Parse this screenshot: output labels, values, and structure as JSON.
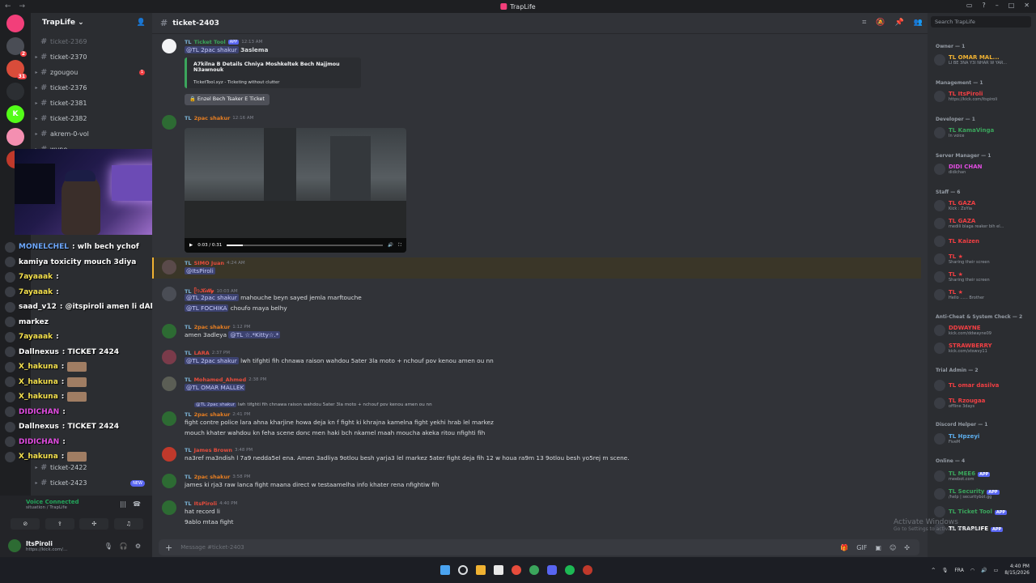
{
  "window": {
    "title": "TrapLife",
    "nav_back": "←",
    "nav_fwd": "→"
  },
  "rail": {
    "servers": [
      {
        "label": "",
        "color": "#f23f7a"
      },
      {
        "label": "",
        "color": "#4a4d55",
        "badge": "2"
      },
      {
        "label": "",
        "color": "#d94c3a",
        "badge": "31"
      },
      {
        "label": "",
        "color": "#2c2f33"
      },
      {
        "label": "K",
        "color": "#53fc18"
      },
      {
        "label": "",
        "color": "#f48fb1"
      },
      {
        "label": "",
        "color": "#c0392b"
      }
    ]
  },
  "server": {
    "name": "TrapLife"
  },
  "channels": [
    {
      "name": "ticket-2369",
      "arrow": false,
      "dim": true
    },
    {
      "name": "ticket-2370",
      "arrow": true
    },
    {
      "name": "zgougou",
      "arrow": true,
      "badge": "1"
    },
    {
      "name": "ticket-2376",
      "arrow": true
    },
    {
      "name": "ticket-2381",
      "arrow": true
    },
    {
      "name": "ticket-2382",
      "arrow": true
    },
    {
      "name": "akrem-0-vol",
      "arrow": true
    },
    {
      "name": "wyne",
      "arrow": true
    }
  ],
  "channels_bottom": [
    {
      "name": "ticket-2422",
      "arrow": true
    },
    {
      "name": "ticket-2423",
      "arrow": true,
      "new": "NEW"
    }
  ],
  "overlay": [
    {
      "name": "MONELCHEL",
      "name_color": "#6ea8fe",
      "text": ": wlh bech ychof",
      "emote": false
    },
    {
      "name": "kamiya toxicity mouch 3diya",
      "name_color": "#ffffff",
      "text": "",
      "emote": false
    },
    {
      "name": "7ayaaak",
      "name_color": "#f4e04d",
      "text": ":",
      "emote": false
    },
    {
      "name": "7ayaaak",
      "name_color": "#f4e04d",
      "text": ":",
      "emote": false
    },
    {
      "name": "saad_v12",
      "name_color": "#ffffff",
      "text": ": @itspiroli amen li dAkhl",
      "emote": false
    },
    {
      "name": "markez",
      "name_color": "#ffffff",
      "text": "",
      "emote": false
    },
    {
      "name": "7ayaaak",
      "name_color": "#f4e04d",
      "text": ":",
      "emote": false
    },
    {
      "name": "Dallnexus",
      "name_color": "#ffffff",
      "text": ": TICKET 2424",
      "emote": false
    },
    {
      "name": "X_hakuna",
      "name_color": "#f4e04d",
      "text": ":",
      "emote": true
    },
    {
      "name": "X_hakuna",
      "name_color": "#f4e04d",
      "text": ":",
      "emote": true
    },
    {
      "name": "X_hakuna",
      "name_color": "#f4e04d",
      "text": ":",
      "emote": true
    },
    {
      "name": "DIDICHAN",
      "name_color": "#e04ce0",
      "text": ":",
      "emote": false
    },
    {
      "name": "Dallnexus",
      "name_color": "#ffffff",
      "text": ": TICKET 2424",
      "emote": false
    },
    {
      "name": "DIDICHAN",
      "name_color": "#e04ce0",
      "text": ":",
      "emote": false
    },
    {
      "name": "X_hakuna",
      "name_color": "#f4e04d",
      "text": ":",
      "emote": true
    }
  ],
  "voice": {
    "title": "Voice Connected",
    "sub": "situation / TrapLife"
  },
  "user": {
    "name": "ItsPiroli",
    "status": "https://kick.com/..."
  },
  "channel": {
    "name": "ticket-2403",
    "placeholder": "Message #ticket-2403"
  },
  "messages": {
    "m1": {
      "tag": "TL",
      "user": "Ticket Tool",
      "app": "APP",
      "time": "12:13 AM",
      "mention": "@TL 2pac shakur",
      "text": "3aslema",
      "embed_title": "A7kilna B Details Chniya Moshkeltek Bech Najjmou N3awnouk",
      "embed_footer": "TicketTool.xyz - Ticketing without clutter",
      "button": "Enzel Bech Tsaker E Ticket"
    },
    "m2": {
      "tag": "TL",
      "user": "2pac shakur",
      "time": "12:16 AM",
      "video_time": "0:03 / 0:31"
    },
    "m3": {
      "tag": "TL",
      "user": "SIMO Juan",
      "time": "4:24 AM",
      "mention": "@ItsPiroli"
    },
    "m4": {
      "tag": "TL",
      "user": "ᥫ᭡𝓚𝓲𝓽𝓽𝔂",
      "time": "10:03 AM",
      "l1_mention": "@TL 2pac shakur",
      "l1_text": "mahouche beyn sayed jemla marftouche",
      "l2_mention": "@TL FOCHIKA",
      "l2_text": "choufo maya belhy"
    },
    "m5": {
      "tag": "TL",
      "user": "2pac shakur",
      "time": "1:12 PM",
      "text": "amen 3adleya",
      "mention": "@TL ☆.*Kitty☆.*"
    },
    "m6": {
      "tag": "TL",
      "user": "LARA",
      "time": "2:37 PM",
      "mention": "@TL 2pac shakur",
      "text": "lwh tifghti fih chnawa raison wahdou 5ater 3la moto + nchouf pov kenou amen ou nn"
    },
    "m7": {
      "tag": "TL",
      "user": "Mohamed_Ahmed",
      "time": "2:38 PM",
      "mention": "@TL OMAR MALLEK"
    },
    "m8": {
      "tag": "TL",
      "user": "2pac shakur",
      "time": "2:41 PM",
      "reply_mention": "@TL 2pac shakur",
      "reply": "lwh tifghti fih chnawa raison wahdou 5ater 3la moto + nchouf pov kenou amen ou nn",
      "l1": "fight contre police lara ahna kharjine howa deja kn f fight ki khrajna kamelna fight yekhi hrab lel markez",
      "l2": "mouch khater wahdou kn feha scene donc men haki bch nkamel maah moucha akeka ritou nfighti fih"
    },
    "m9": {
      "tag": "TL",
      "user": "James Brown",
      "time": "3:48 PM",
      "text": "na3ref ma3ndish l 7a9 nedda5el ena. Amen 3adliya 9otlou besh yarja3 lel markez 5ater fight deja fih 12 w houa ra9m 13 9otlou besh yo5rej m scene."
    },
    "m10": {
      "tag": "TL",
      "user": "2pac shakur",
      "time": "3:58 PM",
      "text": "james ki rja3 raw lanca fight maana direct w testaamelha info khater rena nfightiw fih"
    },
    "m11": {
      "tag": "TL",
      "user": "ItsPiroli",
      "time": "4:40 PM",
      "l1": "hat record li",
      "l2": "9ablo mtaa fight"
    }
  },
  "members": {
    "search": "Search TrapLife",
    "roles": [
      {
        "label": "Owner — 1"
      },
      {
        "label": "Management — 1"
      },
      {
        "label": "Developer — 1"
      },
      {
        "label": "Server Manager — 1"
      },
      {
        "label": "Staff — 6"
      },
      {
        "label": "Anti-Cheat & System Check — 2"
      },
      {
        "label": "Trial Admin — 2"
      },
      {
        "label": "Discord Helper — 1"
      },
      {
        "label": "Online — 4"
      }
    ],
    "list": [
      {
        "name": "TL OMAR MAL...",
        "sub": "LI BE 3NA Y3I NHAR W YAR...",
        "color": "#f0b232"
      },
      {
        "name": "TL ItsPiroli",
        "sub": "https://kick.com/itspiroli",
        "color": "#f23f43"
      },
      {
        "name": "TL KamaVinga",
        "sub": "In voice",
        "color": "#3ba55c"
      },
      {
        "name": "DIDI CHAN",
        "sub": "didichan",
        "color": "#e04ce0"
      },
      {
        "name": "TL GAZA",
        "sub": "Kick : ZoYia",
        "color": "#f23f43"
      },
      {
        "name": "TL GAZA",
        "sub": "medili blaga reaker bih el...",
        "color": "#f23f43"
      },
      {
        "name": "TL Kaizen",
        "sub": "",
        "color": "#f23f43"
      },
      {
        "name": "TL ★",
        "sub": "Sharing their screen",
        "color": "#f23f43"
      },
      {
        "name": "TL ★",
        "sub": "Sharing their screen",
        "color": "#f23f43"
      },
      {
        "name": "TL ★",
        "sub": "Hello ...... Brother",
        "color": "#f23f43"
      },
      {
        "name": "DDWAYNE",
        "sub": "kick.com/ddwayne09",
        "color": "#f23f43"
      },
      {
        "name": "STRAWBERRY",
        "sub": "kick.com/xtswvy11",
        "color": "#f23f43"
      },
      {
        "name": "TL omar dasilva",
        "sub": "",
        "color": "#f23f43"
      },
      {
        "name": "TL Rzougaa",
        "sub": "offline 3days",
        "color": "#f23f43"
      },
      {
        "name": "TL Hpzeyi",
        "sub": "FiveM",
        "color": "#5dadec"
      },
      {
        "name": "TL MEE6",
        "sub": "meebot.com",
        "color": "#3ba55c",
        "app": "APP"
      },
      {
        "name": "TL Security",
        "sub": "/help | securitybot.gg",
        "color": "#3ba55c",
        "app": "APP"
      },
      {
        "name": "TL Ticket Tool",
        "sub": "",
        "color": "#3ba55c",
        "app": "APP"
      },
      {
        "name": "TL TRAPLIFE",
        "sub": "",
        "color": "#ffffff",
        "app": "APP"
      }
    ]
  },
  "watermark": {
    "title": "Activate Windows",
    "sub": "Go to Settings to activate Windows."
  },
  "taskbar": {
    "lang": "FRA",
    "time": "4:40 PM",
    "date": "8/15/2026"
  }
}
